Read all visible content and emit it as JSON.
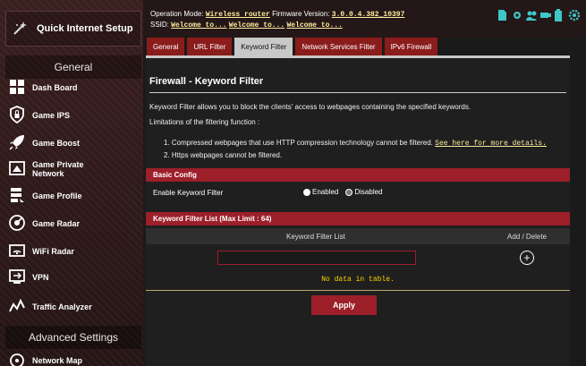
{
  "sidebar": {
    "quick_setup": "Quick Internet Setup",
    "general_header": "General",
    "advanced_header": "Advanced Settings",
    "items": [
      {
        "label": "Dash Board",
        "icon": "dashboard-icon"
      },
      {
        "label": "Game IPS",
        "icon": "shield-lock-icon"
      },
      {
        "label": "Game Boost",
        "icon": "rocket-icon"
      },
      {
        "label": "Game Private\nNetwork",
        "icon": "private-network-icon"
      },
      {
        "label": "Game Profile",
        "icon": "game-profile-icon"
      },
      {
        "label": "Game Radar",
        "icon": "game-radar-icon"
      },
      {
        "label": "WiFi Radar",
        "icon": "wifi-radar-icon"
      },
      {
        "label": "VPN",
        "icon": "vpn-icon"
      },
      {
        "label": "Traffic Analyzer",
        "icon": "traffic-analyzer-icon"
      }
    ],
    "advanced_items": [
      {
        "label": "Network Map",
        "icon": "network-map-icon"
      }
    ]
  },
  "topbar": {
    "op_mode_label": "Operation Mode:",
    "op_mode_value": "Wireless router",
    "fw_label": "Firmware Version:",
    "fw_value": "3.0.0.4.382_10397",
    "ssid_label": "SSID:",
    "ssids": [
      "Welcome to...",
      "Welcome to...",
      "Welcome to..."
    ]
  },
  "tabs": [
    "General",
    "URL Filter",
    "Keyword Filter",
    "Network Services Filter",
    "IPv6 Firewall"
  ],
  "active_tab": "Keyword Filter",
  "main": {
    "title": "Firewall - Keyword Filter",
    "description": "Keyword Filter allows you to block the clients' access to webpages containing the specified keywords.",
    "limitations_label": "Limitations of the filtering function :",
    "limitation_1": "1. Compressed webpages that use HTTP compression technology cannot be filtered.",
    "limitation_1_link": "See here for more details.",
    "limitation_2": "2. Https webpages cannot be filtered.",
    "basic_config_header": "Basic Config",
    "enable_label": "Enable Keyword Filter",
    "enabled_option": "Enabled",
    "disabled_option": "Disabled",
    "selected_option": "Disabled",
    "list_header": "Keyword Filter List (Max Limit : 64)",
    "col_list": "Keyword Filter List",
    "col_action": "Add / Delete",
    "input_value": "",
    "no_data": "No data in table.",
    "apply_label": "Apply"
  },
  "colors": {
    "accent": "#9c1f2a",
    "link": "#ffeb9c",
    "no_data_text": "#ffd700"
  }
}
